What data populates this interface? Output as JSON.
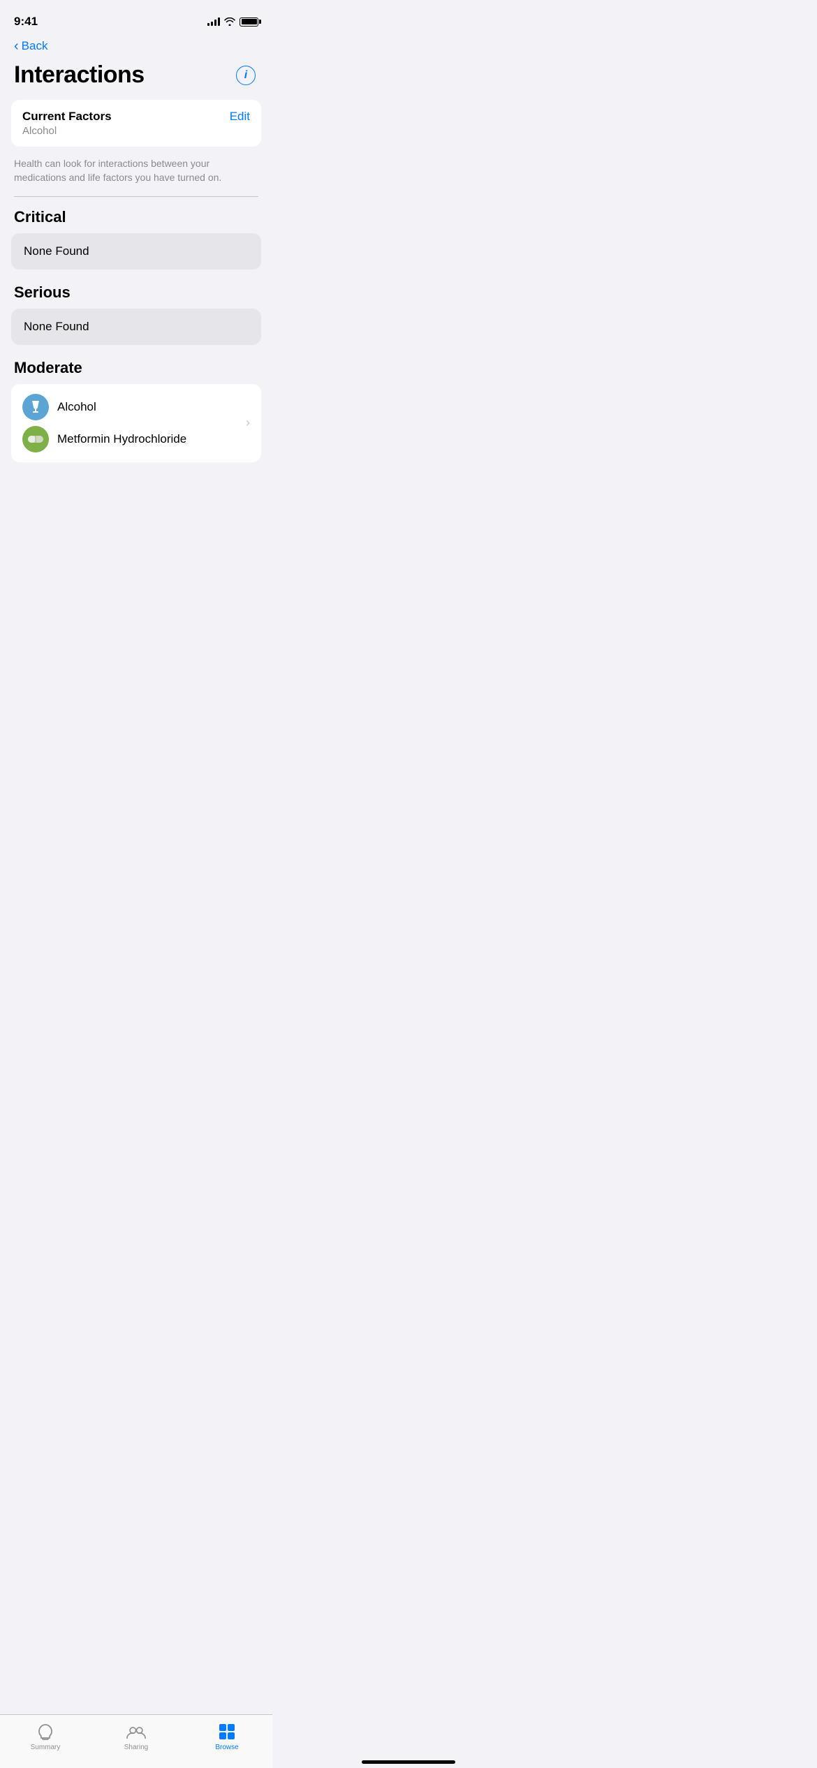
{
  "statusBar": {
    "time": "9:41"
  },
  "navigation": {
    "back_label": "Back"
  },
  "header": {
    "title": "Interactions",
    "info_label": "i"
  },
  "currentFactors": {
    "title": "Current Factors",
    "edit_label": "Edit",
    "factor": "Alcohol",
    "description": "Health can look for interactions between your medications and life factors you have turned on."
  },
  "sections": {
    "critical": {
      "title": "Critical",
      "status": "None Found"
    },
    "serious": {
      "title": "Serious",
      "status": "None Found"
    },
    "moderate": {
      "title": "Moderate",
      "items": [
        {
          "label": "Alcohol"
        },
        {
          "label": "Metformin Hydrochloride"
        }
      ]
    }
  },
  "tabBar": {
    "tabs": [
      {
        "id": "summary",
        "label": "Summary",
        "active": false
      },
      {
        "id": "sharing",
        "label": "Sharing",
        "active": false
      },
      {
        "id": "browse",
        "label": "Browse",
        "active": true
      }
    ]
  }
}
